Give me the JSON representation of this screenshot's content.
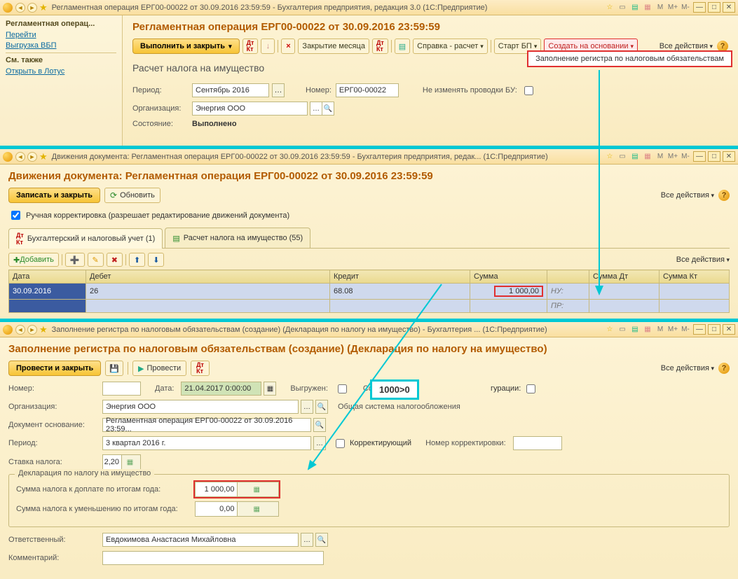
{
  "win1": {
    "title": "Регламентная операция ЕРГ00-00022 от 30.09.2016 23:59:59 - Бухгалтерия предприятия, редакция 3.0  (1С:Предприятие)",
    "sidebar": {
      "section1_title": "Регламентная операц...",
      "link_goto": "Перейти",
      "link_vbp": "Выгрузка ВБП",
      "section2_title": "См. также",
      "link_lotus": "Открыть в Лотус"
    },
    "heading": "Регламентная операция ЕРГ00-00022 от 30.09.2016 23:59:59",
    "toolbar": {
      "exec_close": "Выполнить и закрыть",
      "close_month": "Закрытие месяца",
      "report": "Справка - расчет",
      "start_bp": "Старт БП",
      "create_based": "Создать на основании",
      "all_actions": "Все действия"
    },
    "popup_item": "Заполнение регистра по налоговым обязательствам",
    "subheading": "Расчет налога на имущество",
    "form": {
      "period_label": "Период:",
      "period_value": "Сентябрь 2016",
      "number_label": "Номер:",
      "number_value": "ЕРГ00-00022",
      "lock_label": "Не изменять проводки БУ:",
      "org_label": "Организация:",
      "org_value": "Энергия ООО",
      "state_label": "Состояние:",
      "state_value": "Выполнено"
    }
  },
  "win2": {
    "title": "Движения документа: Регламентная операция ЕРГ00-00022 от 30.09.2016 23:59:59 - Бухгалтерия предприятия, редак...  (1С:Предприятие)",
    "heading": "Движения документа: Регламентная операция ЕРГ00-00022 от 30.09.2016 23:59:59",
    "toolbar": {
      "save_close": "Записать и закрыть",
      "refresh": "Обновить",
      "all_actions": "Все действия"
    },
    "manual_edit": "Ручная корректировка (разрешает редактирование движений документа)",
    "tabs": {
      "tab1": "Бухгалтерский и налоговый учет (1)",
      "tab2": "Расчет налога на имущество (55)"
    },
    "toolbar3": {
      "add": "Добавить",
      "all_actions": "Все действия"
    },
    "table": {
      "headers": [
        "Дата",
        "Дебет",
        "Кредит",
        "Сумма",
        "",
        "Сумма Дт",
        "Сумма Кт"
      ],
      "row": {
        "date": "30.09.2016",
        "debit": "26",
        "credit": "68.08",
        "sum": "1 000,00",
        "nu": "НУ:",
        "pr": "ПР:"
      }
    }
  },
  "win3": {
    "title": "Заполнение регистра по налоговым обязательствам (создание) (Декларация по налогу на имущество) - Бухгалтерия ...  (1С:Предприятие)",
    "heading": "Заполнение регистра по налоговым обязательствам (создание) (Декларация по налогу на имущество)",
    "toolbar": {
      "post_close": "Провести и закрыть",
      "post": "Провести",
      "all_actions": "Все действия"
    },
    "form": {
      "number_label": "Номер:",
      "date_label": "Дата:",
      "date_value": "21.04.2017 0:00:00",
      "exported_label": "Выгружен:",
      "formed_label": "Сформирован",
      "config_label": "гурации:",
      "org_label": "Организация:",
      "org_value": "Энергия ООО",
      "tax_system": "Общая система налогообложения",
      "base_doc_label": "Документ основание:",
      "base_doc_value": "Регламентная операция ЕРГ00-00022 от 30.09.2016 23:59...",
      "period_label": "Период:",
      "period_value": "3 квартал 2016 г.",
      "correcting_label": "Корректирующий",
      "corr_num_label": "Номер корректировки:",
      "rate_label": "Ставка налога:",
      "rate_value": "2,20"
    },
    "fieldset": {
      "legend": "Декларация по налогу на имущество",
      "sum_pay_label": "Сумма налога к доплате по итогам года:",
      "sum_pay_value": "1 000,00",
      "sum_reduce_label": "Сумма налога к уменьшению по итогам года:",
      "sum_reduce_value": "0,00"
    },
    "responsible_label": "Ответственный:",
    "responsible_value": "Евдокимова Анастасия Михайловна",
    "comment_label": "Комментарий:"
  },
  "callout": "1000>0"
}
